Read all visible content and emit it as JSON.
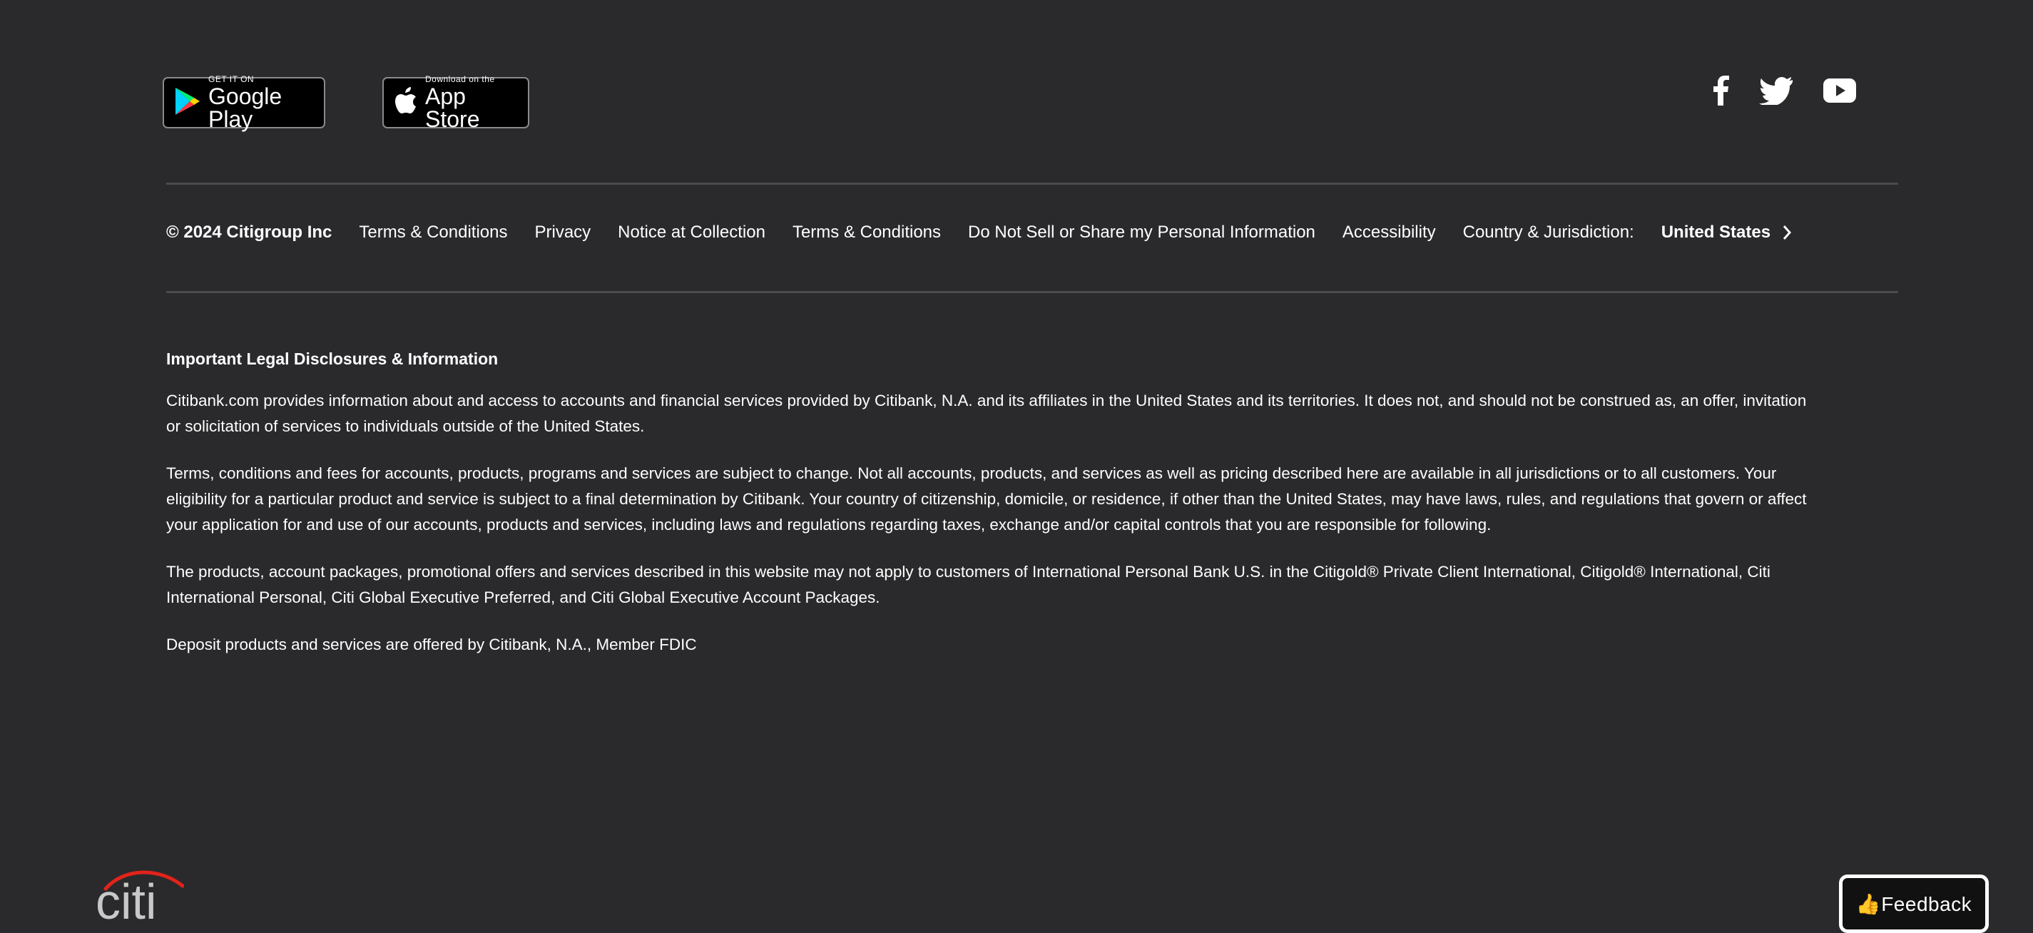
{
  "store_badges": {
    "google_play": {
      "small": "GET IT ON",
      "big": "Google Play"
    },
    "app_store": {
      "small": "Download on the",
      "big": "App Store"
    }
  },
  "social_icons": [
    "facebook-icon",
    "twitter-icon",
    "youtube-icon"
  ],
  "legal_bar": {
    "copyright": "© 2024 Citigroup Inc",
    "links": [
      "Terms & Conditions",
      "Privacy",
      "Notice at Collection",
      "Terms & Conditions",
      "Do Not Sell or Share my Personal Information",
      "Accessibility",
      "Country & Jurisdiction:"
    ],
    "country": "United States"
  },
  "disclosures": {
    "heading": "Important Legal Disclosures & Information",
    "paragraphs": [
      "Citibank.com provides information about and access to accounts and financial services provided by Citibank, N.A. and its affiliates in the United States and its territories. It does not, and should not be construed as, an offer, invitation or solicitation of services to individuals outside of the United States.",
      "Terms, conditions and fees for accounts, products, programs and services are subject to change. Not all accounts, products, and services as well as pricing described here are available in all jurisdictions or to all customers. Your eligibility for a particular product and service is subject to a final determination by Citibank. Your country of citizenship, domicile, or residence, if other than the United States, may have laws, rules, and regulations that govern or affect your application for and use of our accounts, products and services, including laws and regulations regarding taxes, exchange and/or capital controls that you are responsible for following.",
      "The products, account packages, promotional offers and services described in this website may not apply to customers of International Personal Bank U.S. in the Citigold® Private Client International, Citigold® International, Citi International Personal, Citi Global Executive Preferred, and Citi Global Executive Account Packages.",
      "Deposit products and services are offered by Citibank, N.A., Member FDIC"
    ]
  },
  "logo": {
    "text": "citi"
  },
  "feedback": {
    "label": "👍Feedback"
  }
}
